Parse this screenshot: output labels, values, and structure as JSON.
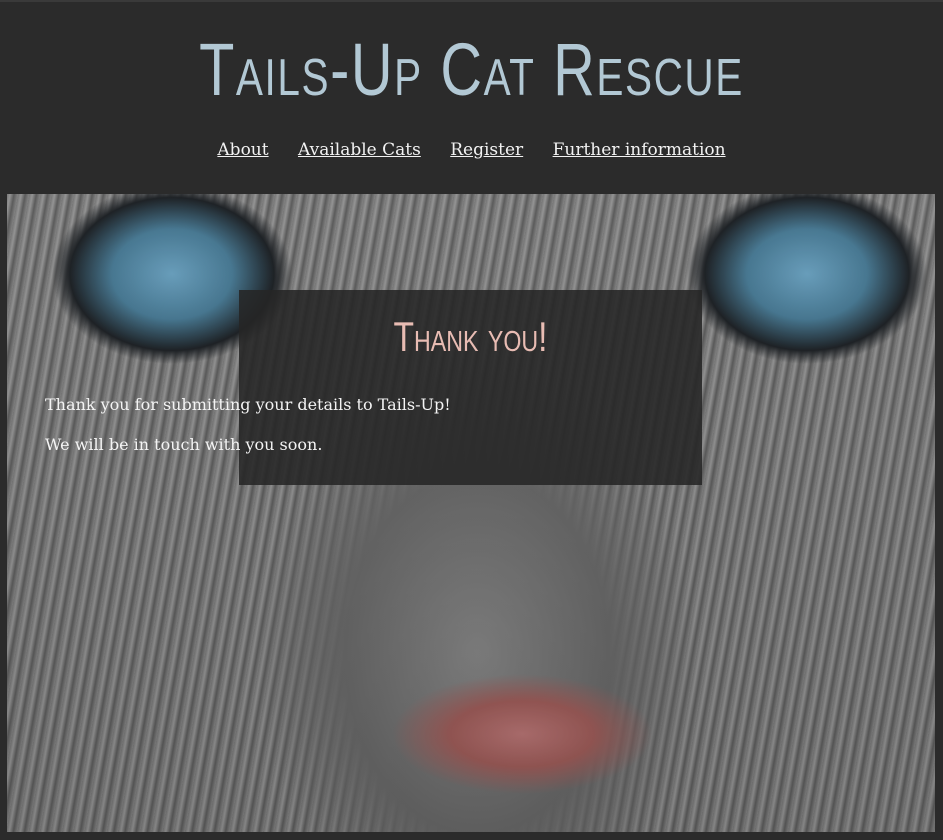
{
  "header": {
    "title": "Tails-Up Cat Rescue"
  },
  "nav": {
    "items": [
      {
        "label": "About"
      },
      {
        "label": "Available Cats"
      },
      {
        "label": "Register"
      },
      {
        "label": "Further information"
      }
    ]
  },
  "hero": {
    "image": "cat-face-photo"
  },
  "message": {
    "title": "Thank you!",
    "line1": "Thank you for submitting your details to Tails-Up!",
    "line2": "We will be in touch with you soon."
  },
  "colors": {
    "background": "#2b2b2b",
    "title": "#b2c8d4",
    "message_title": "#e8bcb3",
    "text": "#f2f2f2"
  }
}
